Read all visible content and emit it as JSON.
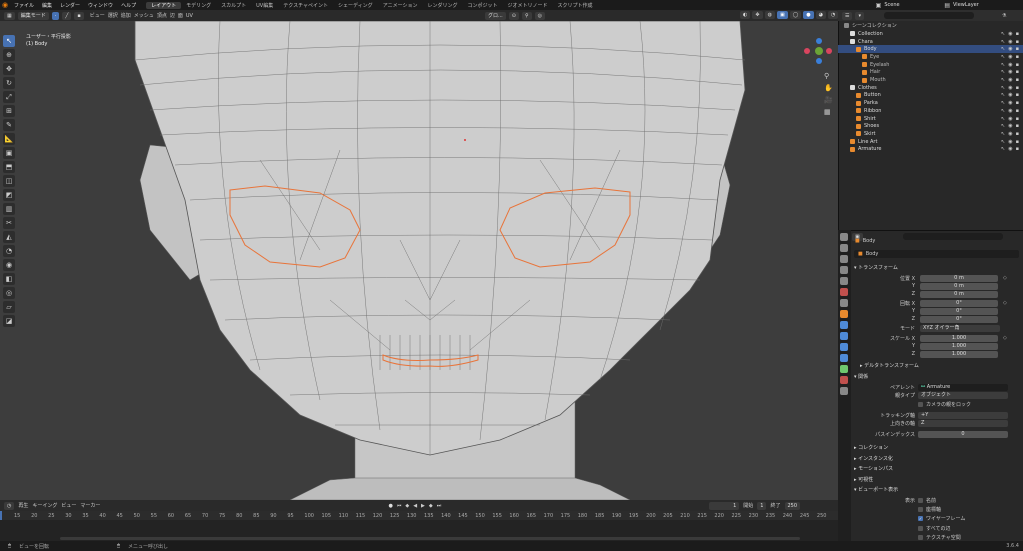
{
  "topbar": {
    "menus": [
      "ファイル",
      "編集",
      "レンダー",
      "ウィンドウ",
      "ヘルプ"
    ],
    "workspaces": [
      "レイアウト",
      "モデリング",
      "スカルプト",
      "UV編集",
      "テクスチャペイント",
      "シェーディング",
      "アニメーション",
      "レンダリング",
      "コンポジット",
      "ジオメトリノード",
      "スクリプト作成"
    ],
    "active_workspace": "レイアウト",
    "scene": "Scene",
    "view_layer": "ViewLayer"
  },
  "viewport_header": {
    "mode": "編集モード",
    "menus": [
      "ビュー",
      "選択",
      "追加",
      "メッシュ",
      "頂点",
      "辺",
      "面",
      "UV"
    ],
    "transform": "グロ...",
    "options": "オプション"
  },
  "viewport_info": {
    "view_name": "ユーザー・平行投影",
    "object": "(1) Body"
  },
  "timeline": {
    "menus": [
      "再生",
      "キーイング",
      "ビュー",
      "マーカー"
    ],
    "current_frame": "1",
    "start_label": "開始",
    "start": "1",
    "end_label": "終了",
    "end": "250",
    "ticks": [
      "15",
      "20",
      "25",
      "30",
      "35",
      "40",
      "45",
      "50",
      "55",
      "60",
      "65",
      "70",
      "75",
      "80",
      "85",
      "90",
      "95",
      "100",
      "105",
      "110",
      "115",
      "120",
      "125",
      "130",
      "135",
      "140",
      "145",
      "150",
      "155",
      "160",
      "165",
      "170",
      "175",
      "180",
      "185",
      "190",
      "195",
      "200",
      "205",
      "210",
      "215",
      "220",
      "225",
      "230",
      "235",
      "240",
      "245",
      "250"
    ]
  },
  "statusbar": {
    "items": [
      "ビューを回転",
      "メニュー呼び出し"
    ],
    "version": "3.6.4"
  },
  "outliner": {
    "root": "シーンコレクション",
    "rows": [
      {
        "label": "Collection",
        "indent": 1,
        "kind": "collection"
      },
      {
        "label": "Chara",
        "indent": 1,
        "kind": "collection"
      },
      {
        "label": "Body",
        "indent": 2,
        "kind": "mesh",
        "selected": true
      },
      {
        "label": "Eye",
        "indent": 3,
        "kind": "mesh"
      },
      {
        "label": "Eyelash",
        "indent": 3,
        "kind": "mesh"
      },
      {
        "label": "Hair",
        "indent": 3,
        "kind": "mesh"
      },
      {
        "label": "Mouth",
        "indent": 3,
        "kind": "mesh"
      },
      {
        "label": "Clothes",
        "indent": 1,
        "kind": "collection"
      },
      {
        "label": "Button",
        "indent": 2,
        "kind": "mesh"
      },
      {
        "label": "Parka",
        "indent": 2,
        "kind": "mesh"
      },
      {
        "label": "Ribbon",
        "indent": 2,
        "kind": "mesh"
      },
      {
        "label": "Shirt",
        "indent": 2,
        "kind": "mesh"
      },
      {
        "label": "Shoes",
        "indent": 2,
        "kind": "mesh"
      },
      {
        "label": "Skirt",
        "indent": 2,
        "kind": "mesh"
      },
      {
        "label": "Line Art",
        "indent": 1,
        "kind": "gp"
      },
      {
        "label": "Armature",
        "indent": 1,
        "kind": "armature"
      }
    ]
  },
  "properties": {
    "object_name": "Body",
    "object_name_field": "Body",
    "transform": {
      "section": "トランスフォーム",
      "location_label": "位置 X",
      "rotation_label": "回転 X",
      "scale_label": "スケール X",
      "axis_y": "Y",
      "axis_z": "Z",
      "loc": [
        "0 m",
        "0 m",
        "0 m"
      ],
      "rot": [
        "0°",
        "0°",
        "0°"
      ],
      "mode_label": "モード",
      "mode": "XYZ オイラー角",
      "scale": [
        "1.000",
        "1.000",
        "1.000"
      ]
    },
    "delta": "デルタトランスフォーム",
    "relations": {
      "section": "関係",
      "parent_label": "ペアレント",
      "parent": "Armature",
      "parent_type_label": "親タイプ",
      "parent_type": "オブジェクト",
      "lock_camera": "カメラの親をロック",
      "track_label": "トラッキング軸",
      "track": "+Y",
      "up_label": "上向きの軸",
      "up": "Z",
      "pass_label": "パスインデックス",
      "pass": "0"
    },
    "collapsed": [
      "コレクション",
      "インスタンス化",
      "モーションパス",
      "可視性"
    ],
    "viewport_display": {
      "section": "ビューポート表示",
      "show_label": "表示",
      "checks": [
        {
          "label": "名前",
          "checked": false
        },
        {
          "label": "座標軸",
          "checked": false
        },
        {
          "label": "ワイヤーフレーム",
          "checked": true
        },
        {
          "label": "すべての辺",
          "checked": false
        },
        {
          "label": "テクスチャ空間",
          "checked": false
        }
      ]
    }
  },
  "colors": {
    "accent": "#4772b3",
    "selected_edge": "#e8743a",
    "viewport_bg": "#3d3d3d",
    "mesh": "#c9c9c9"
  }
}
